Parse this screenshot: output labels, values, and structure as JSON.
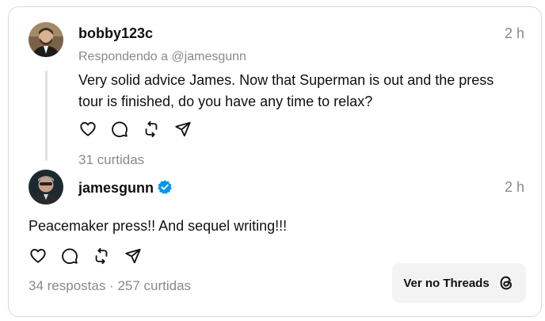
{
  "reply_post": {
    "username": "bobby123c",
    "time": "2 h",
    "replying_to": "Respondendo a @jamesgunn",
    "text_line1": "Very solid advice James. Now that Superman is out and the press",
    "text_line2": "tour is finished, do you have any time to relax?",
    "stats": "31 curtidas"
  },
  "main_post": {
    "username": "jamesgunn",
    "verified": true,
    "time": "2 h",
    "text": "Peacemaker press!! And sequel writing!!!",
    "stats": "34 respostas · 257 curtidas"
  },
  "open_button": {
    "label": "Ver no Threads"
  },
  "colors": {
    "text": "#101010",
    "muted": "#8a8a8a",
    "verified": "#0095f6",
    "button_bg": "#f3f3f3"
  },
  "icons": [
    "heart-icon",
    "comment-icon",
    "repost-icon",
    "share-icon",
    "threads-logo-icon",
    "verified-badge-icon"
  ]
}
